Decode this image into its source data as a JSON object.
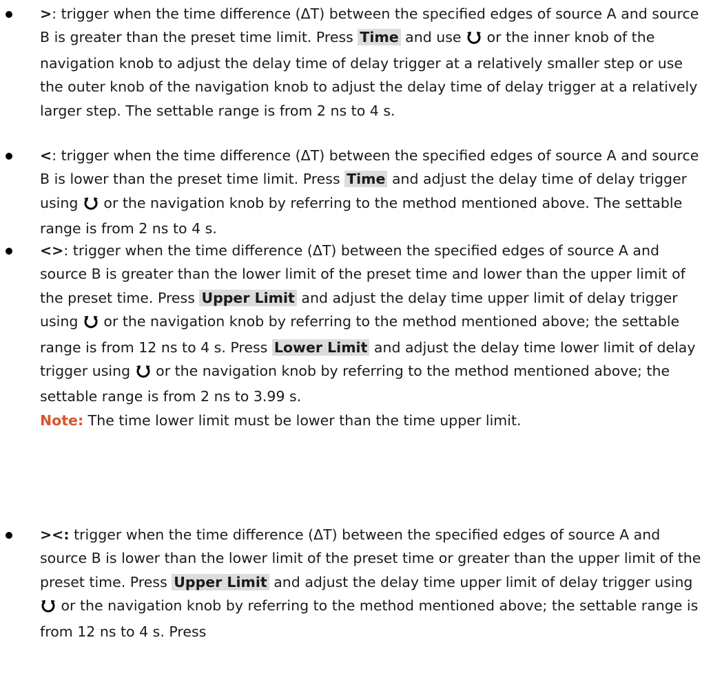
{
  "items": [
    {
      "op": ">",
      "t1": ": trigger when the time difference (ΔT) between the specified edges of source A and source B is greater than the preset time limit. Press ",
      "btn1": "Time",
      "t2": " and use ",
      "t3": " or the inner knob of the navigation knob to adjust the delay time of delay trigger at a relatively smaller step or use the outer knob of the navigation knob to adjust the delay time of delay trigger at a relatively larger step. The settable range is from 2 ns to 4 s."
    },
    {
      "op": "<",
      "t1": ": trigger when the time difference (ΔT) between the specified edges of source A and source B is lower than the preset time limit. Press ",
      "btn1": "Time",
      "t2": " and adjust the delay time of delay trigger using ",
      "t3": " or the navigation knob by referring to the method mentioned above. The settable range is from 2 ns to 4 s."
    },
    {
      "op": "<>",
      "t1": ": trigger when the time difference (ΔT) between the specified edges of source A and source B is greater than the lower limit of the preset time and lower than the upper limit of the preset time. Press ",
      "btn1": "Upper Limit",
      "t2": " and adjust the delay time upper limit of delay trigger using ",
      "t3": " or the navigation knob by referring to the method mentioned above; the settable range is from 12 ns to 4 s. Press ",
      "btn2": "Lower Limit",
      "t4": " and adjust the delay time lower limit of delay trigger using ",
      "t5": " or the navigation knob by referring to the method mentioned above; the settable range is from 2 ns to 3.99 s.",
      "note_label": "Note:",
      "note_text": " The time lower limit must be lower than the time upper limit."
    },
    {
      "op": "><:",
      "t1": " trigger when the time difference (ΔT) between the specified edges of source A and source B is lower than the lower limit of the preset time or greater than the upper limit of the preset time. Press ",
      "btn1": "Upper Limit",
      "t2": " and adjust the delay time upper limit of delay trigger using ",
      "t3": " or the navigation knob by referring to the method mentioned above; the settable range is from 12 ns to 4 s. Press"
    }
  ]
}
